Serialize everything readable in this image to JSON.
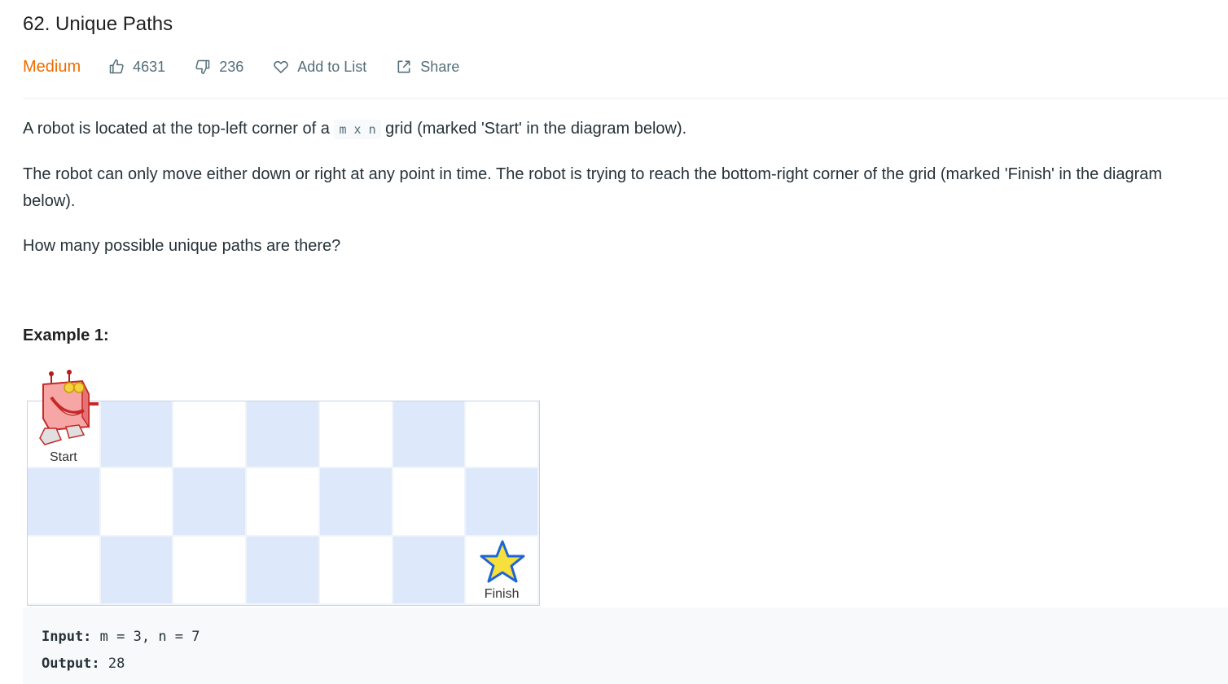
{
  "problem": {
    "title": "62. Unique Paths",
    "difficulty": "Medium",
    "likes": "4631",
    "dislikes": "236",
    "add_to_list": "Add to List",
    "share": "Share"
  },
  "description": {
    "p1_before": "A robot is located at the top-left corner of a ",
    "p1_code": "m x n",
    "p1_after": " grid (marked 'Start' in the diagram below).",
    "p2": "The robot can only move either down or right at any point in time. The robot is trying to reach the bottom-right corner of the grid (marked 'Finish' in the diagram below).",
    "p3": "How many possible unique paths are there?"
  },
  "example": {
    "title": "Example 1:",
    "grid": {
      "rows": 3,
      "cols": 7,
      "start_label": "Start",
      "finish_label": "Finish",
      "light_color": "#dde9fb"
    },
    "input_label": "Input:",
    "input_value": "m = 3, n = 7",
    "output_label": "Output:",
    "output_value": "28"
  },
  "colors": {
    "difficulty": "#ef6c00",
    "text": "#263238",
    "meta": "#546e7a"
  },
  "icons": [
    "thumbs-up-icon",
    "thumbs-down-icon",
    "heart-icon",
    "share-icon",
    "robot-icon",
    "star-icon"
  ]
}
